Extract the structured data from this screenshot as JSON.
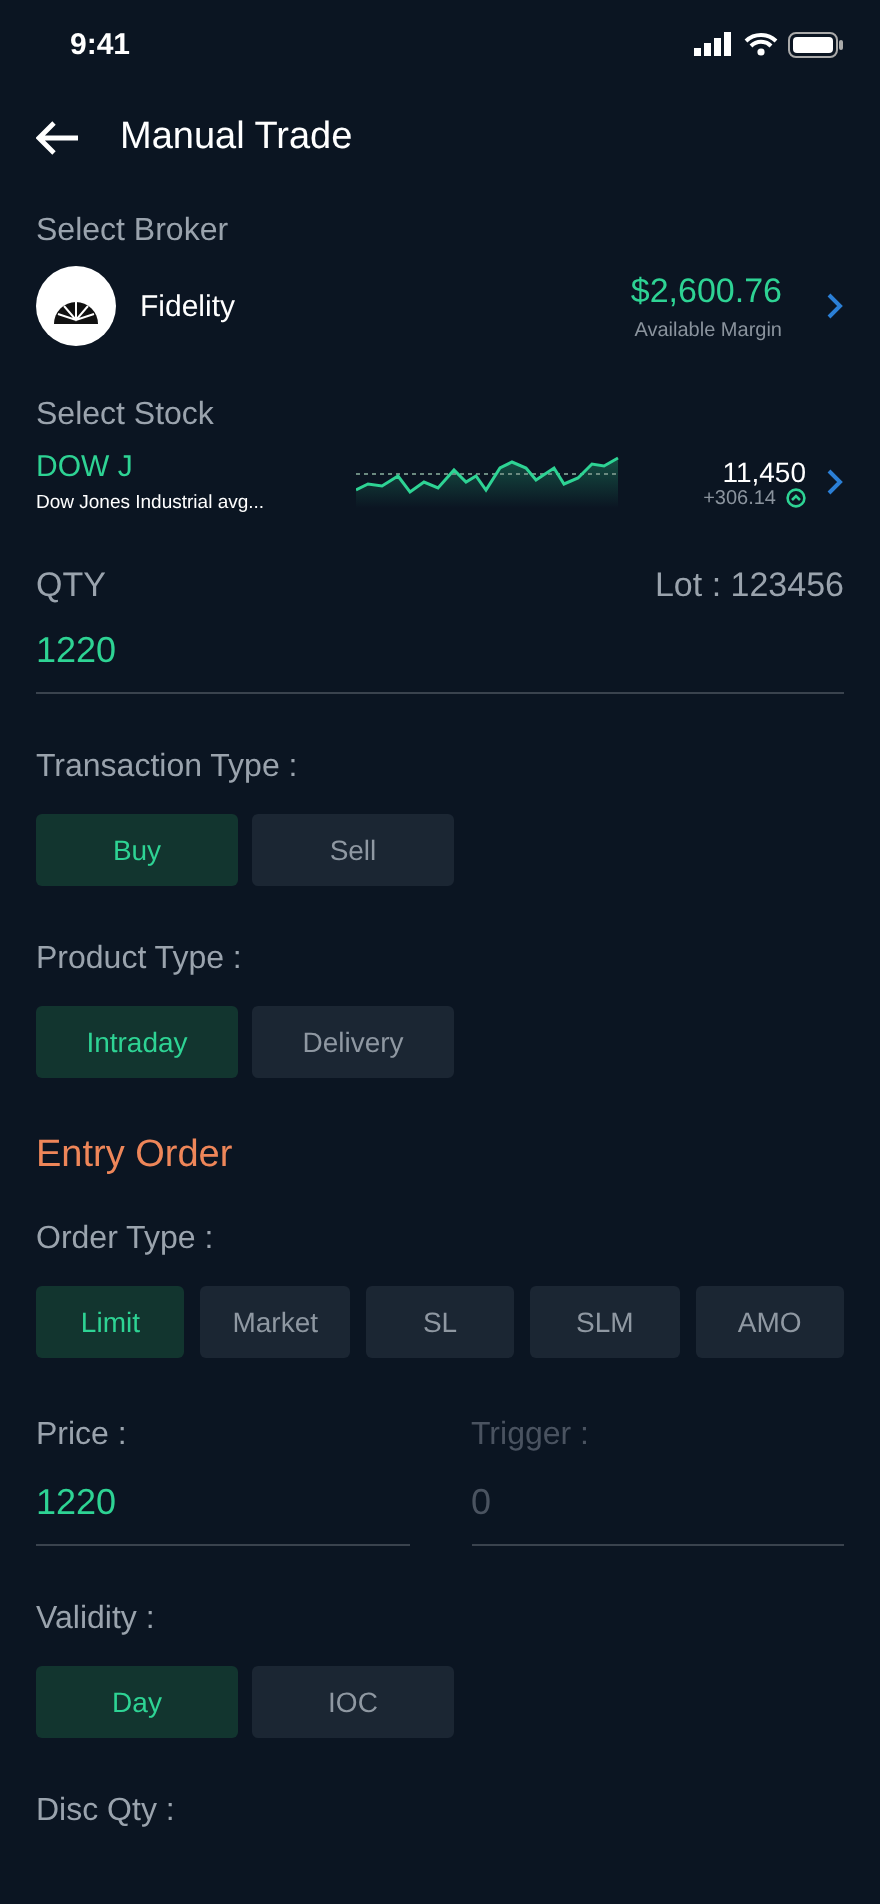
{
  "status_bar": {
    "time": "9:41"
  },
  "header": {
    "title": "Manual Trade"
  },
  "broker": {
    "label": "Select Broker",
    "name": "Fidelity",
    "amount": "$2,600.76",
    "caption": "Available Margin"
  },
  "stock": {
    "label": "Select Stock",
    "symbol": "DOW J",
    "name": "Dow Jones Industrial avg...",
    "price": "11,450",
    "change": "+306.14"
  },
  "qty": {
    "label": "QTY",
    "lot": "Lot : 123456",
    "value": "1220"
  },
  "transaction_type": {
    "label": "Transaction Type :",
    "options": [
      {
        "label": "Buy",
        "selected": true
      },
      {
        "label": "Sell",
        "selected": false
      }
    ]
  },
  "product_type": {
    "label": "Product Type :",
    "options": [
      {
        "label": "Intraday",
        "selected": true
      },
      {
        "label": "Delivery",
        "selected": false
      }
    ]
  },
  "entry_order": {
    "title": "Entry Order"
  },
  "order_type": {
    "label": "Order Type :",
    "options": [
      {
        "label": "Limit",
        "selected": true
      },
      {
        "label": "Market",
        "selected": false
      },
      {
        "label": "SL",
        "selected": false
      },
      {
        "label": "SLM",
        "selected": false
      },
      {
        "label": "AMO",
        "selected": false
      }
    ]
  },
  "price_fields": [
    {
      "label": "Price :",
      "value": "1220",
      "disabled": false
    },
    {
      "label": "Trigger :",
      "value": "0",
      "disabled": true
    }
  ],
  "validity": {
    "label": "Validity :",
    "options": [
      {
        "label": "Day",
        "selected": true
      },
      {
        "label": "IOC",
        "selected": false
      }
    ]
  },
  "disc_qty": {
    "label": "Disc Qty :"
  }
}
